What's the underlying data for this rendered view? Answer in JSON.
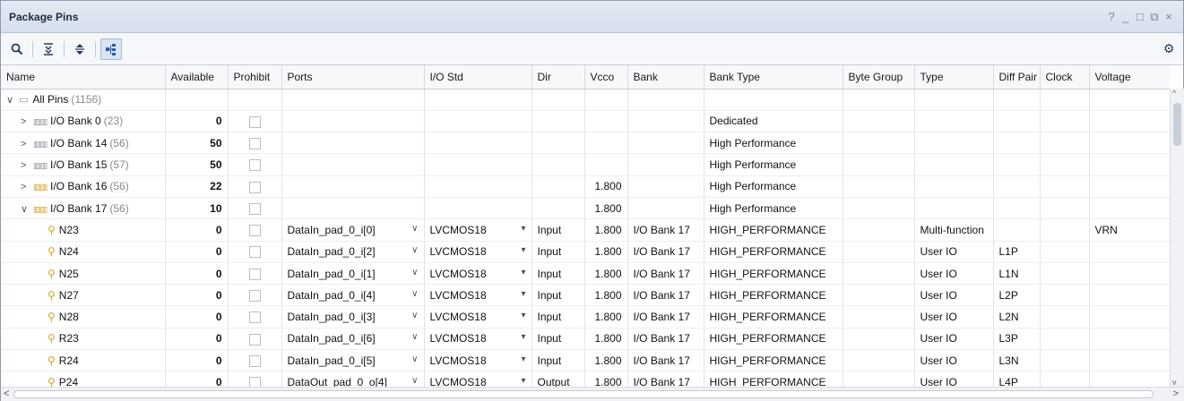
{
  "window": {
    "title": "Package Pins",
    "controls": [
      "?",
      "_",
      "□",
      "⧉",
      "×"
    ]
  },
  "toolbar": {
    "buttons": [
      {
        "name": "search-icon",
        "glyph": "⚲"
      },
      {
        "name": "collapse-all-icon",
        "glyph": "⇊"
      },
      {
        "name": "expand-all-icon",
        "glyph": "⇕"
      },
      {
        "name": "group-by-icon",
        "glyph": "⊞"
      }
    ],
    "settings_icon": "⚙"
  },
  "columns": [
    "Name",
    "Available",
    "Prohibit",
    "Ports",
    "I/O Std",
    "Dir",
    "Vcco",
    "Bank",
    "Bank Type",
    "Byte Group",
    "Type",
    "Diff Pair",
    "Clock",
    "Voltage"
  ],
  "rows": [
    {
      "level": 0,
      "expander": "∨",
      "icon": "folder",
      "name": "All Pins",
      "count": "(1156)",
      "bold": false,
      "available": "",
      "prohibit": false,
      "ports": "",
      "iostd": "",
      "dir": "",
      "vcco": "",
      "bank": "",
      "banktype": "",
      "bytegroup": "",
      "type": "",
      "diffpair": "",
      "clock": "",
      "voltage": ""
    },
    {
      "level": 1,
      "expander": ">",
      "icon": "bank",
      "name": "I/O Bank 0",
      "count": "(23)",
      "bold": false,
      "available": "0",
      "prohibit": true,
      "ports": "",
      "iostd": "",
      "dir": "",
      "vcco": "",
      "bank": "",
      "banktype": "Dedicated",
      "bytegroup": "",
      "type": "",
      "diffpair": "",
      "clock": "",
      "voltage": ""
    },
    {
      "level": 1,
      "expander": ">",
      "icon": "bank",
      "name": "I/O Bank 14",
      "count": "(56)",
      "bold": false,
      "available": "50",
      "prohibit": true,
      "ports": "",
      "iostd": "",
      "dir": "",
      "vcco": "",
      "bank": "",
      "banktype": "High Performance",
      "bytegroup": "",
      "type": "",
      "diffpair": "",
      "clock": "",
      "voltage": ""
    },
    {
      "level": 1,
      "expander": ">",
      "icon": "bank",
      "name": "I/O Bank 15",
      "count": "(57)",
      "bold": false,
      "available": "50",
      "prohibit": true,
      "ports": "",
      "iostd": "",
      "dir": "",
      "vcco": "",
      "bank": "",
      "banktype": "High Performance",
      "bytegroup": "",
      "type": "",
      "diffpair": "",
      "clock": "",
      "voltage": ""
    },
    {
      "level": 1,
      "expander": ">",
      "icon": "bank-warm",
      "name": "I/O Bank 16",
      "count": "(56)",
      "bold": false,
      "available": "22",
      "prohibit": true,
      "ports": "",
      "iostd": "",
      "dir": "",
      "vcco": "1.800",
      "bank": "",
      "banktype": "High Performance",
      "bytegroup": "",
      "type": "",
      "diffpair": "",
      "clock": "",
      "voltage": ""
    },
    {
      "level": 1,
      "expander": "∨",
      "icon": "bank-warm",
      "name": "I/O Bank 17",
      "count": "(56)",
      "bold": false,
      "available": "10",
      "prohibit": true,
      "ports": "",
      "iostd": "",
      "dir": "",
      "vcco": "1.800",
      "bank": "",
      "banktype": "High Performance",
      "bytegroup": "",
      "type": "",
      "diffpair": "",
      "clock": "",
      "voltage": ""
    },
    {
      "level": 2,
      "expander": "",
      "icon": "pin",
      "name": "N23",
      "count": "",
      "bold": false,
      "available": "0",
      "prohibit": true,
      "ports": "DataIn_pad_0_i[0]",
      "iostd": "LVCMOS18",
      "dir": "Input",
      "vcco": "1.800",
      "bank": "I/O Bank 17",
      "banktype": "HIGH_PERFORMANCE",
      "bytegroup": "",
      "type": "Multi-function",
      "diffpair": "",
      "clock": "",
      "voltage": "VRN"
    },
    {
      "level": 2,
      "expander": "",
      "icon": "pin",
      "name": "N24",
      "count": "",
      "bold": false,
      "available": "0",
      "prohibit": true,
      "ports": "DataIn_pad_0_i[2]",
      "iostd": "LVCMOS18",
      "dir": "Input",
      "vcco": "1.800",
      "bank": "I/O Bank 17",
      "banktype": "HIGH_PERFORMANCE",
      "bytegroup": "",
      "type": "User IO",
      "diffpair": "L1P",
      "clock": "",
      "voltage": ""
    },
    {
      "level": 2,
      "expander": "",
      "icon": "pin",
      "name": "N25",
      "count": "",
      "bold": false,
      "available": "0",
      "prohibit": true,
      "ports": "DataIn_pad_0_i[1]",
      "iostd": "LVCMOS18",
      "dir": "Input",
      "vcco": "1.800",
      "bank": "I/O Bank 17",
      "banktype": "HIGH_PERFORMANCE",
      "bytegroup": "",
      "type": "User IO",
      "diffpair": "L1N",
      "clock": "",
      "voltage": ""
    },
    {
      "level": 2,
      "expander": "",
      "icon": "pin",
      "name": "N27",
      "count": "",
      "bold": false,
      "available": "0",
      "prohibit": true,
      "ports": "DataIn_pad_0_i[4]",
      "iostd": "LVCMOS18",
      "dir": "Input",
      "vcco": "1.800",
      "bank": "I/O Bank 17",
      "banktype": "HIGH_PERFORMANCE",
      "bytegroup": "",
      "type": "User IO",
      "diffpair": "L2P",
      "clock": "",
      "voltage": ""
    },
    {
      "level": 2,
      "expander": "",
      "icon": "pin",
      "name": "N28",
      "count": "",
      "bold": false,
      "available": "0",
      "prohibit": true,
      "ports": "DataIn_pad_0_i[3]",
      "iostd": "LVCMOS18",
      "dir": "Input",
      "vcco": "1.800",
      "bank": "I/O Bank 17",
      "banktype": "HIGH_PERFORMANCE",
      "bytegroup": "",
      "type": "User IO",
      "diffpair": "L2N",
      "clock": "",
      "voltage": ""
    },
    {
      "level": 2,
      "expander": "",
      "icon": "pin",
      "name": "R23",
      "count": "",
      "bold": false,
      "available": "0",
      "prohibit": true,
      "ports": "DataIn_pad_0_i[6]",
      "iostd": "LVCMOS18",
      "dir": "Input",
      "vcco": "1.800",
      "bank": "I/O Bank 17",
      "banktype": "HIGH_PERFORMANCE",
      "bytegroup": "",
      "type": "User IO",
      "diffpair": "L3P",
      "clock": "",
      "voltage": ""
    },
    {
      "level": 2,
      "expander": "",
      "icon": "pin",
      "name": "R24",
      "count": "",
      "bold": false,
      "available": "0",
      "prohibit": true,
      "ports": "DataIn_pad_0_i[5]",
      "iostd": "LVCMOS18",
      "dir": "Input",
      "vcco": "1.800",
      "bank": "I/O Bank 17",
      "banktype": "HIGH_PERFORMANCE",
      "bytegroup": "",
      "type": "User IO",
      "diffpair": "L3N",
      "clock": "",
      "voltage": ""
    },
    {
      "level": 2,
      "expander": "",
      "icon": "pin",
      "name": "P24",
      "count": "",
      "bold": false,
      "available": "0",
      "prohibit": true,
      "ports": "DataOut_pad_0_o[4]",
      "iostd": "LVCMOS18",
      "dir": "Output",
      "vcco": "1.800",
      "bank": "I/O Bank 17",
      "banktype": "HIGH_PERFORMANCE",
      "bytegroup": "",
      "type": "User IO",
      "diffpair": "L4P",
      "clock": "",
      "voltage": ""
    }
  ]
}
